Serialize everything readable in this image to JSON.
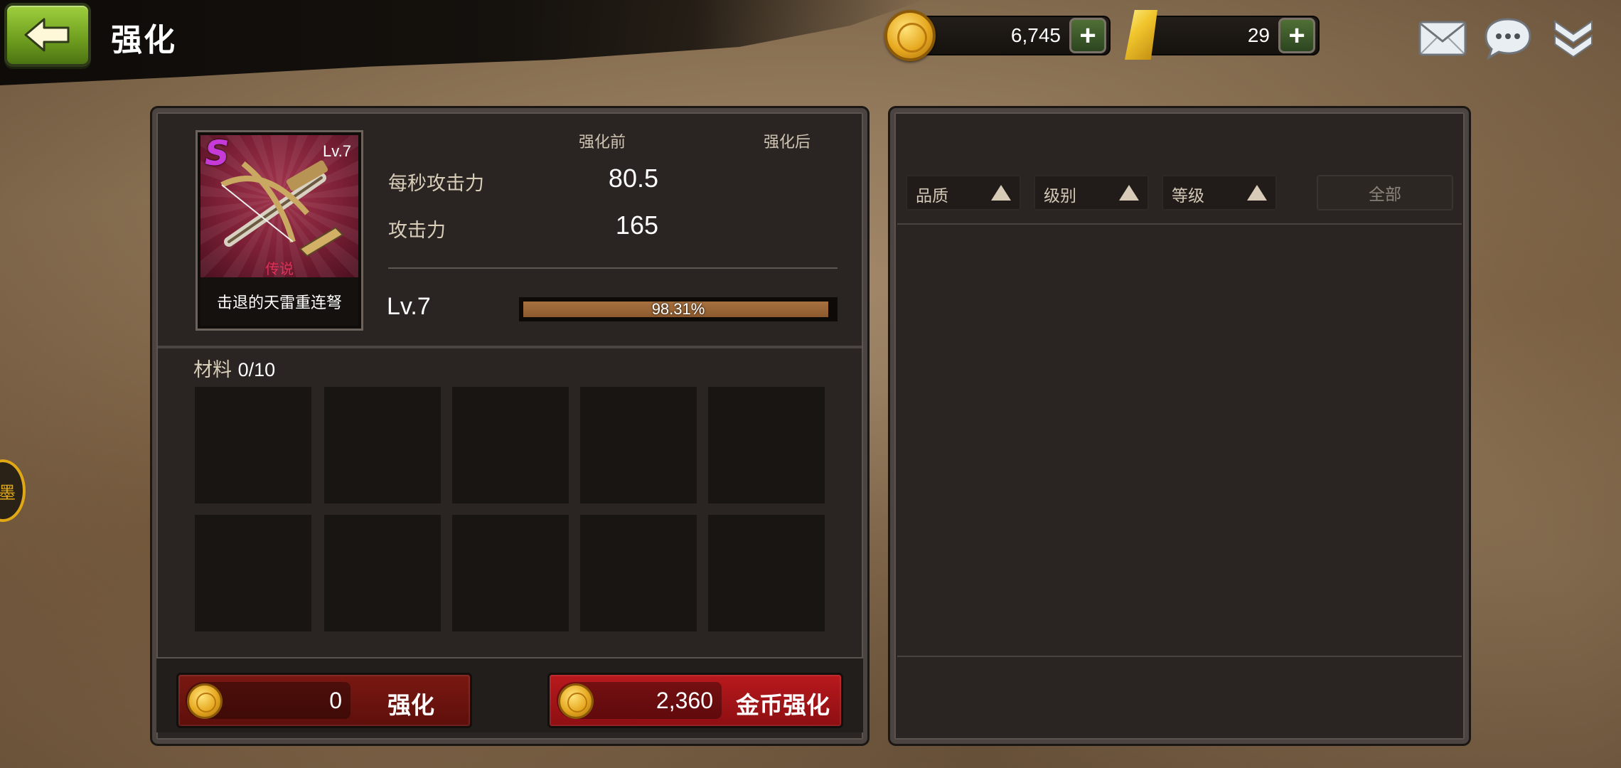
{
  "header": {
    "title": "强化",
    "gold_amount": "6,745",
    "bar_amount": "29",
    "plus_symbol": "+"
  },
  "item_card": {
    "grade": "S",
    "level": "Lv.7",
    "rarity": "传说",
    "name": "击退的天雷重连弩"
  },
  "stats": {
    "before_header": "强化前",
    "after_header": "强化后",
    "rows": [
      {
        "label": "每秒攻击力",
        "before": "80.5",
        "after": ""
      },
      {
        "label": "攻击力",
        "before": "165",
        "after": ""
      }
    ]
  },
  "level_progress": {
    "level": "Lv.7",
    "percent_text": "98.31%",
    "fraction": 0.9831
  },
  "materials": {
    "label": "材料",
    "count": "0/10",
    "slots": 10
  },
  "actions": {
    "enhance": {
      "cost": "0",
      "label": "强化"
    },
    "gold_enhance": {
      "cost": "2,360",
      "label": "金币强化"
    }
  },
  "filters": {
    "items": [
      {
        "label": "品质"
      },
      {
        "label": "级别"
      },
      {
        "label": "等级"
      }
    ],
    "all_label": "全部"
  },
  "side_badge": {
    "text": "墨"
  },
  "colors": {
    "back_button": "#8cc232",
    "enhance_button": "#6e1410",
    "gold_enhance_button": "#a8161a",
    "progress_fill": "#98623a",
    "grade_s": "#c63bd8",
    "rarity_legendary": "#e0315a"
  },
  "icons": {
    "back": "arrow-left-icon",
    "gold": "gold-coin-icon",
    "bar": "gold-bar-icon",
    "mail": "mail-icon",
    "chat": "chat-bubble-icon",
    "menu": "double-chevron-down-icon"
  }
}
